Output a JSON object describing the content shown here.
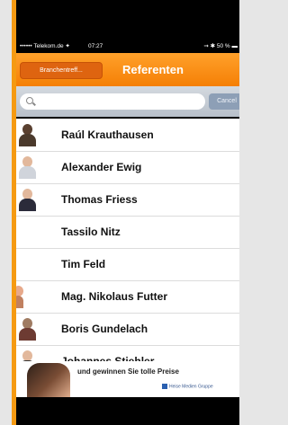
{
  "status_bar": {
    "carrier": "•••••• Telekom.de ✦",
    "time": "07:27",
    "right": "⇝ ✱ 50 % ▬"
  },
  "navbar": {
    "back_label": "Branchentreff...",
    "title": "Referenten"
  },
  "search": {
    "placeholder": "",
    "cancel_label": "Cancel"
  },
  "referenten": [
    "Raúl Krauthausen",
    "Alexander Ewig",
    "Thomas Friess",
    "Tassilo Nitz",
    "Tim Feld",
    "Mag. Nikolaus Futter",
    "Boris Gundelach",
    "Johannes Stiehler"
  ],
  "ad": {
    "headline": "und gewinnen Sie tolle Preise",
    "brand": "Heise Medien Gruppe"
  }
}
